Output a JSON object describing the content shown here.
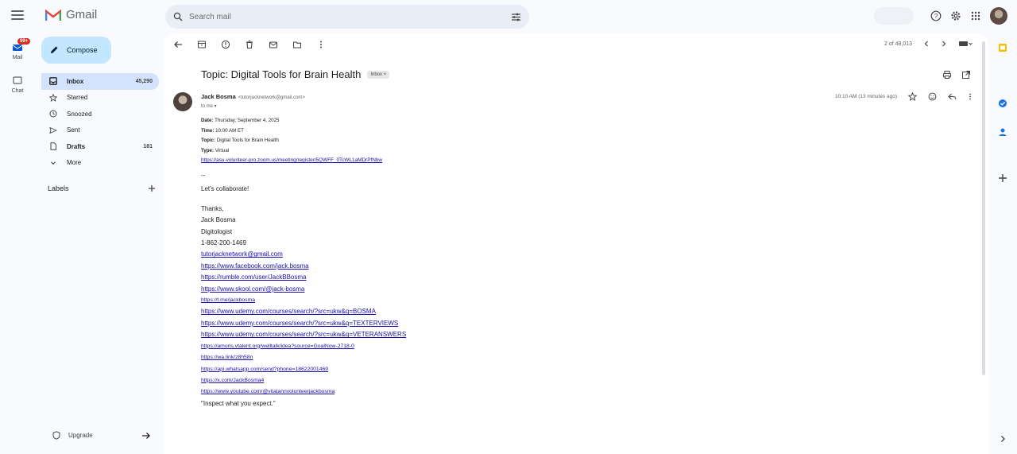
{
  "header": {
    "app_name": "Gmail",
    "search_placeholder": "Search mail"
  },
  "rail": {
    "mail_label": "Mail",
    "mail_badge": "99+",
    "chat_label": "Chat"
  },
  "sidebar": {
    "compose_label": "Compose",
    "items": [
      {
        "label": "Inbox",
        "count": "45,290",
        "icon": "inbox-icon"
      },
      {
        "label": "Starred",
        "count": "",
        "icon": "star-icon"
      },
      {
        "label": "Snoozed",
        "count": "",
        "icon": "clock-icon"
      },
      {
        "label": "Sent",
        "count": "",
        "icon": "send-icon"
      },
      {
        "label": "Drafts",
        "count": "181",
        "icon": "draft-icon"
      },
      {
        "label": "More",
        "count": "",
        "icon": "chevron-down-icon"
      }
    ],
    "labels_heading": "Labels",
    "upgrade_label": "Upgrade"
  },
  "toolbar": {
    "pager_text": "2 of 48,013"
  },
  "message": {
    "subject": "Topic: Digital Tools for Brain Health",
    "tag": "Inbox ×",
    "sender_name": "Jack Bosma",
    "sender_email": "<tutorjacknetwork@gmail.com>",
    "to_line": "to me ▾",
    "time": "10:10 AM (13 minutes ago)",
    "details": [
      {
        "key": "Date",
        "value": "Thursday, September 4, 2025"
      },
      {
        "key": "Time",
        "value": "10:00 AM ET"
      },
      {
        "key": "Topic",
        "value": "Digital Tools for Brain Health"
      },
      {
        "key": "Type",
        "value": "Virtual"
      }
    ],
    "meeting_link": "https://asu-volunteer-pro.zoom.us/meeting/register/5QWFF_0TcWL1aMDrPfNbw",
    "separator": "--",
    "collab_line": "Let's collaborate!",
    "signature": {
      "thanks": "Thanks,",
      "name": "Jack Bosma",
      "title": "Digitologist",
      "phone": "1-862-200-1469",
      "links": [
        "tutorjacknetwork@gmail.com",
        "https://www.facebook.com/jack.bosma",
        "https://rumble.com/user/JackBBosma",
        "https://www.skool.com/@jack-bosma",
        "https://t.me/jackbosma",
        "https://www.udemy.com/courses/search/?src=ukw&q=BOSMA",
        "https://www.udemy.com/courses/search/?src=ukw&q=TEXTERVIEWS",
        "https://www.udemy.com/courses/search/?src=ukw&q=VETERANSWERS",
        "https://amoris.vtalent.org/welltalk/idea?source=GoalNow-2718-0",
        "https://wa.link/z8h58n",
        "https://api.whatsapp.com/send?phone=18622001469",
        "https://x.com/JackBosma4",
        "https://www.youtube.com/@vitalannvolunteerjackbosma"
      ],
      "quote": "\"Inspect what you expect.\""
    }
  }
}
